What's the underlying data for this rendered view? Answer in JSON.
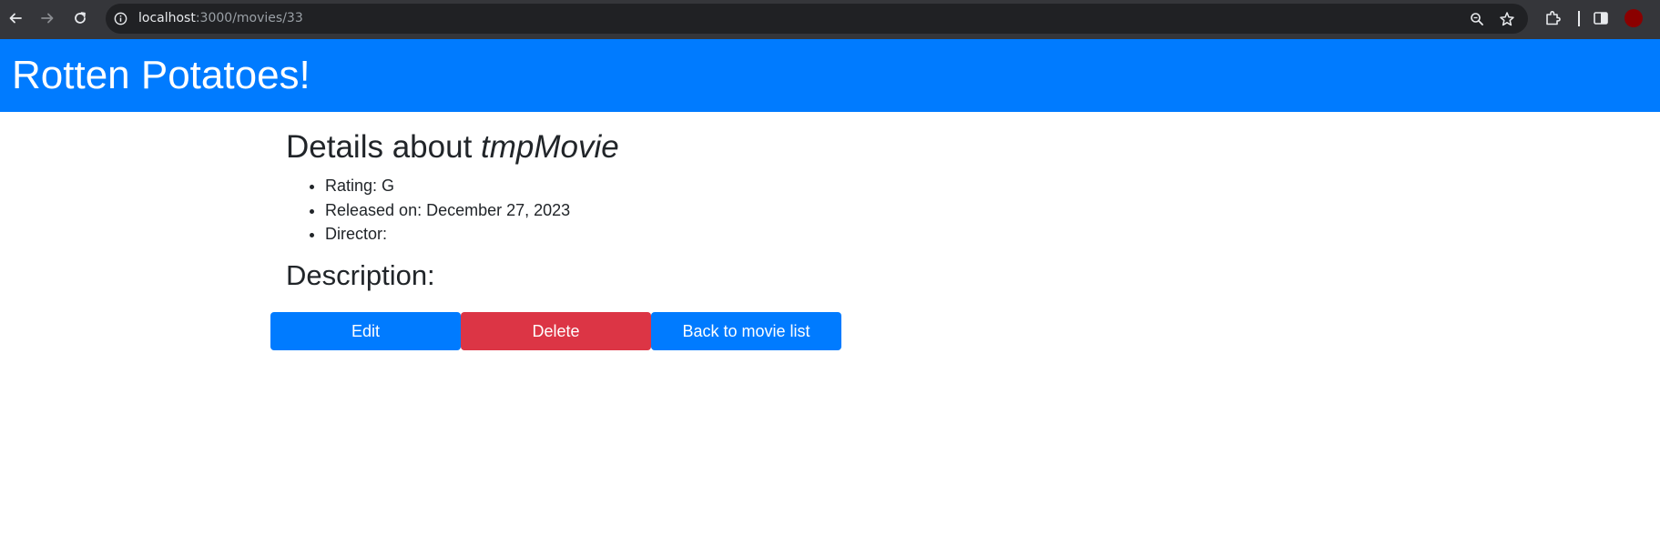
{
  "browser": {
    "url_host": "localhost",
    "url_path": ":3000/movies/33",
    "icons": {
      "back": "back-arrow-icon",
      "forward": "forward-arrow-icon",
      "reload": "reload-icon",
      "site_info": "info-icon",
      "zoom": "zoom-icon",
      "bookmark": "star-icon",
      "extensions": "puzzle-icon",
      "side_panel": "side-panel-icon",
      "profile": "profile-avatar"
    },
    "colors": {
      "toolbar": "#35363a",
      "omnibox": "#202124",
      "profile": "#8b0000"
    }
  },
  "header": {
    "title": "Rotten Potatoes!",
    "background": "#007bff"
  },
  "movie": {
    "heading_prefix": "Details about ",
    "title": "tmpMovie",
    "rating": "Rating: G",
    "released": "Released on: December 27, 2023",
    "director": "Director:",
    "description_heading": "Description:"
  },
  "actions": {
    "edit_label": "Edit",
    "delete_label": "Delete",
    "back_label": "Back to movie list",
    "colors": {
      "primary": "#007bff",
      "danger": "#dc3545"
    }
  }
}
